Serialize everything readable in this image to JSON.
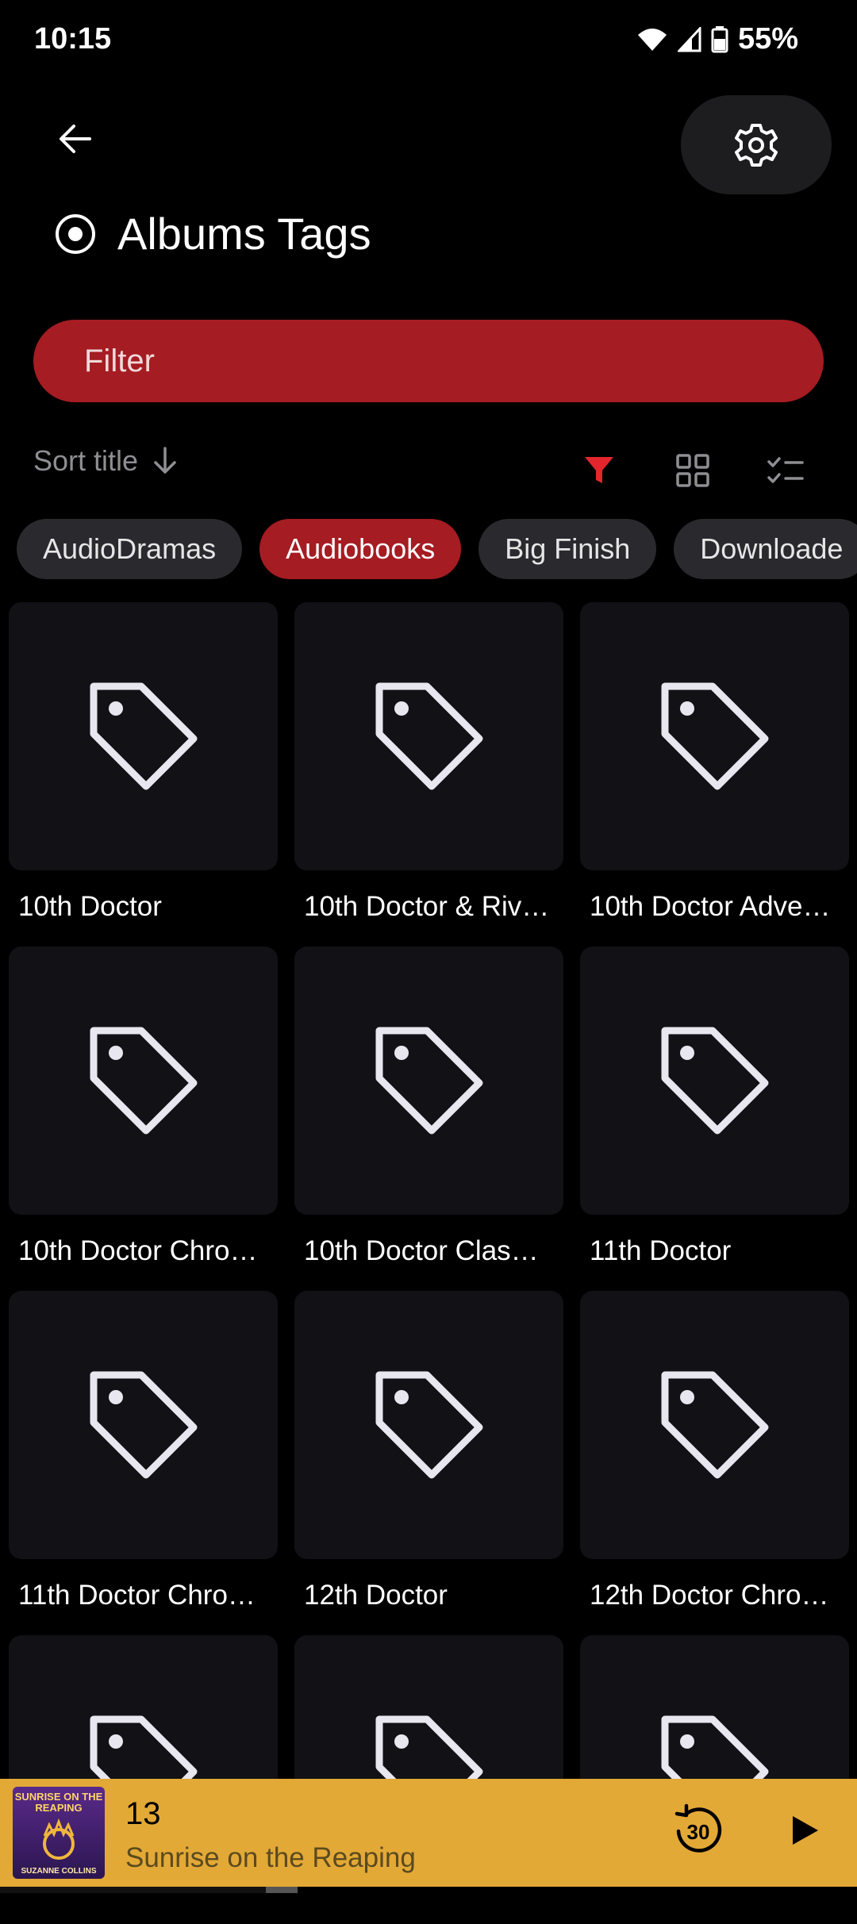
{
  "status": {
    "time": "10:15",
    "battery": "55%"
  },
  "header": {
    "title": "Albums Tags"
  },
  "filter": {
    "label": "Filter"
  },
  "sort": {
    "label": "Sort title"
  },
  "chips": [
    {
      "label": "AudioDramas",
      "active": false
    },
    {
      "label": "Audiobooks",
      "active": true
    },
    {
      "label": "Big Finish",
      "active": false
    },
    {
      "label": "Downloade",
      "active": false
    }
  ],
  "tags": [
    "10th Doctor",
    "10th Doctor & Riv…",
    "10th Doctor Adve…",
    "10th Doctor Chro…",
    "10th Doctor Clas…",
    "11th Doctor",
    "11th Doctor Chro…",
    "12th Doctor",
    "12th Doctor Chro…",
    "",
    "",
    ""
  ],
  "player": {
    "track_number": "13",
    "track_title": "Sunrise on the Reaping",
    "album_art_title": "SUNRISE ON THE REAPING",
    "album_art_author": "SUZANNE COLLINS",
    "replay_seconds": "30",
    "progress": 0.31
  },
  "colors": {
    "accent": "#a51c22",
    "player_bg": "#e3a937",
    "tile_bg": "#111116"
  },
  "icons": [
    "back-arrow-icon",
    "gear-icon",
    "album-disc-icon",
    "sort-arrow-down-icon",
    "filter-funnel-icon",
    "grid-view-icon",
    "checklist-icon",
    "tag-icon",
    "replay-30-icon",
    "play-icon"
  ]
}
